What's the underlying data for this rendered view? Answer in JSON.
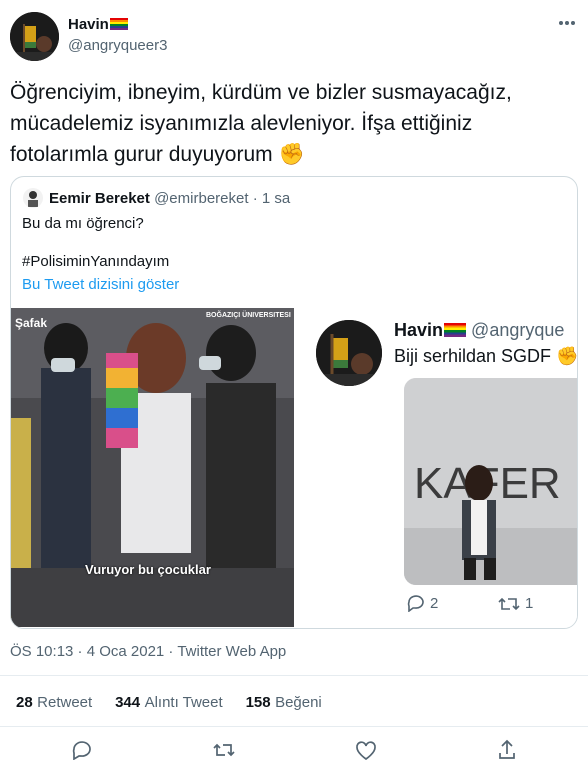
{
  "tweet": {
    "author_name": "Havin",
    "author_handle": "@angryqueer3",
    "text_lines": [
      "Öğrenciyim, ibneyim, kürdüm ve bizler susmayacağız,",
      "mücadelemiz isyanımızla alevleniyor. İfşa ettiğiniz",
      "fotolarımla gurur duyuyorum"
    ],
    "emoji": "✊",
    "timestamp": "ÖS 10:13 · 4 Oca 2021 · Twitter Web App"
  },
  "quoted": {
    "author_name": "Eemir Bereket",
    "author_handle": "@emirbereket",
    "time": "· 1 sa",
    "text": "Bu da mı öğrenci?",
    "hashtag": "#PolisiminYanındayım",
    "thread_link": "Bu Tweet dizisini göster",
    "video": {
      "watermark_left": "Şafak",
      "watermark_right": "BOĞAZIÇI ÜNIVERSITESI",
      "caption": "Vuruyor bu çocuklar"
    },
    "inner_tweet": {
      "author_name": "Havin",
      "author_handle": "@angryque",
      "text": "Biji serhildan SGDF",
      "emoji": "✊",
      "graffiti": "KAFER",
      "replies": "2",
      "retweets": "1"
    }
  },
  "stats": {
    "retweets": "28",
    "retweets_label": "Retweet",
    "quotes": "344",
    "quotes_label": "Alıntı Tweet",
    "likes": "158",
    "likes_label": "Beğeni"
  },
  "colors": {
    "link": "#1d9bf0",
    "muted": "#536471",
    "border": "#cfd9de"
  },
  "icons": [
    "reply-icon",
    "retweet-icon",
    "like-icon",
    "share-icon",
    "more-icon"
  ]
}
